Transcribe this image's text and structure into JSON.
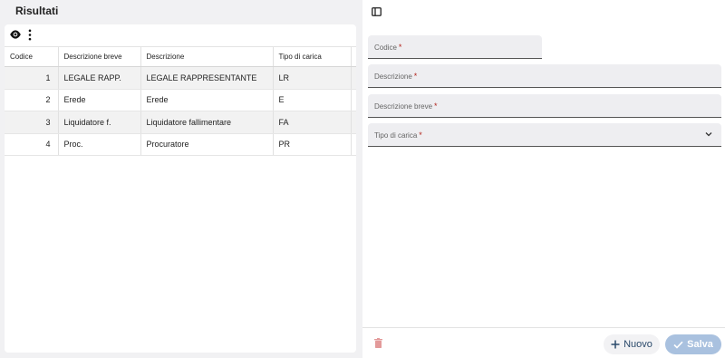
{
  "results": {
    "title": "Risultati",
    "columns": [
      "Codice",
      "Descrizione breve",
      "Descrizione",
      "Tipo di carica"
    ],
    "rows": [
      {
        "code": "1",
        "short": "LEGALE RAPP.",
        "desc": "LEGALE RAPPRESENTANTE",
        "type": "LR"
      },
      {
        "code": "2",
        "short": "Erede",
        "desc": "Erede",
        "type": "E"
      },
      {
        "code": "3",
        "short": "Liquidatore f.",
        "desc": "Liquidatore fallimentare",
        "type": "FA"
      },
      {
        "code": "4",
        "short": "Proc.",
        "desc": "Procuratore",
        "type": "PR"
      }
    ]
  },
  "form": {
    "codice_label": "Codice",
    "descrizione_label": "Descrizione",
    "descrizione_breve_label": "Descrizione breve",
    "tipo_label": "Tipo di carica",
    "required_mark": "*"
  },
  "footer": {
    "new_label": "Nuovo",
    "save_label": "Salva"
  },
  "colors": {
    "accent": "#2b4a6b",
    "save_disabled": "#a9c1df",
    "required": "#b3261e",
    "delete_disabled": "#e39a9a"
  },
  "icons": [
    "eye-icon",
    "more-vert-icon",
    "side-panel-icon",
    "chevron-down-icon",
    "trash-icon",
    "plus-icon",
    "check-icon"
  ]
}
